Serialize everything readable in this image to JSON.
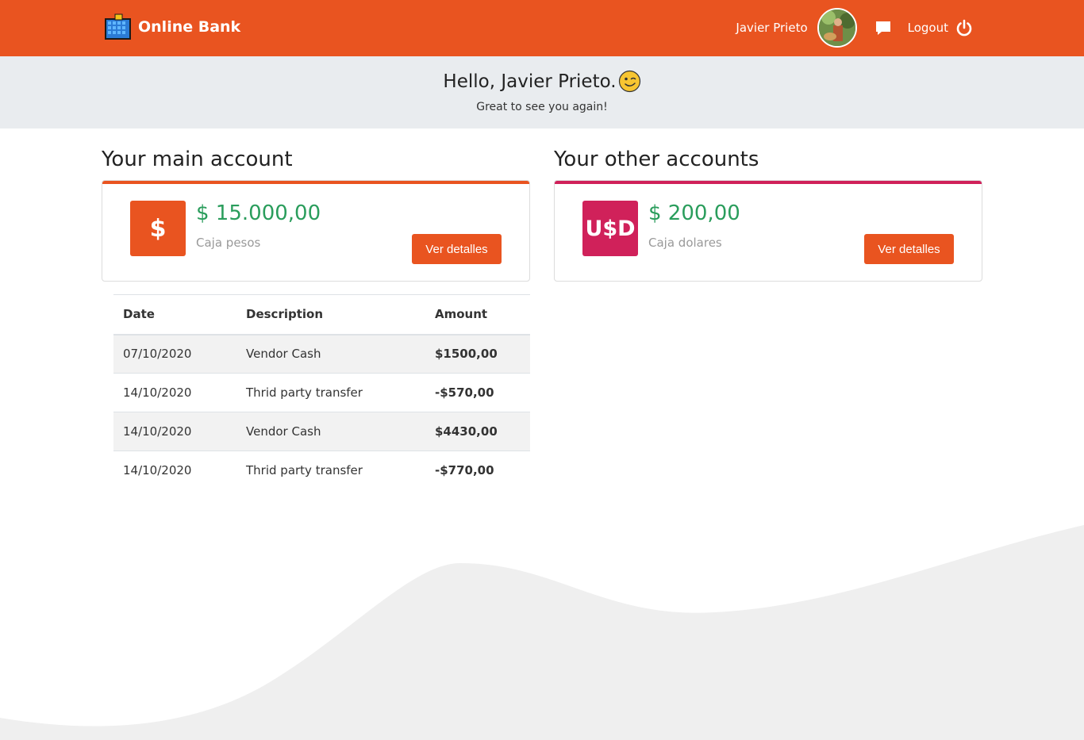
{
  "brand": {
    "name": "Online Bank"
  },
  "nav": {
    "user_name": "Javier Prieto",
    "logout_label": "Logout"
  },
  "greeting": {
    "title": "Hello, Javier Prieto.",
    "subtitle": "Great to see you again!"
  },
  "main_account": {
    "heading": "Your main account",
    "icon_label": "$",
    "amount": "$ 15.000,00",
    "name": "Caja pesos",
    "button_label": "Ver detalles",
    "accent_color": "#e95420"
  },
  "other_accounts": {
    "heading": "Your other accounts",
    "icon_label": "U$D",
    "amount": "$ 200,00",
    "name": "Caja dolares",
    "button_label": "Ver detalles",
    "accent_color": "#d0215a"
  },
  "transactions": {
    "columns": [
      "Date",
      "Description",
      "Amount"
    ],
    "rows": [
      {
        "date": "07/10/2020",
        "description": "Vendor Cash",
        "amount": "$1500,00"
      },
      {
        "date": "14/10/2020",
        "description": "Thrid party transfer",
        "amount": "-$570,00"
      },
      {
        "date": "14/10/2020",
        "description": "Vendor Cash",
        "amount": "$4430,00"
      },
      {
        "date": "14/10/2020",
        "description": "Thrid party transfer",
        "amount": "-$770,00"
      }
    ]
  },
  "colors": {
    "primary": "#e95420",
    "secondary": "#d0215a",
    "positive": "#2a9d5c"
  },
  "icons": [
    "bank-logo-icon",
    "avatar",
    "chat-icon",
    "power-icon",
    "wink-emoji-icon"
  ]
}
